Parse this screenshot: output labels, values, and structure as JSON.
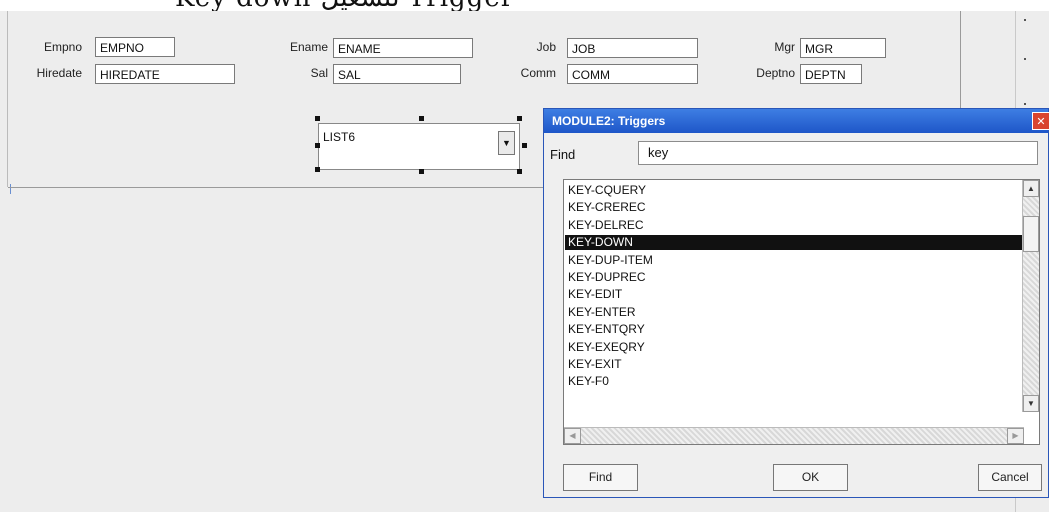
{
  "banner": {
    "text": "Key down لتشغيل Trigger"
  },
  "form": {
    "fields": [
      {
        "label": "Empno",
        "value": "EMPNO"
      },
      {
        "label": "Hiredate",
        "value": "HIREDATE"
      },
      {
        "label": "Ename",
        "value": "ENAME"
      },
      {
        "label": "Sal",
        "value": "SAL"
      },
      {
        "label": "Job",
        "value": "JOB"
      },
      {
        "label": "Comm",
        "value": "COMM"
      },
      {
        "label": "Mgr",
        "value": "MGR"
      },
      {
        "label": "Deptno",
        "value": "DEPTN"
      }
    ],
    "list_item": {
      "value": "LIST6",
      "dropdown_icon": "chevron-down-icon"
    }
  },
  "dialog": {
    "title": "MODULE2: Triggers",
    "close_icon": "close-icon",
    "find_label": "Find",
    "find_value": "key",
    "triggers": [
      "KEY-CQUERY",
      "KEY-CREREC",
      "KEY-DELREC",
      "KEY-DOWN",
      "KEY-DUP-ITEM",
      "KEY-DUPREC",
      "KEY-EDIT",
      "KEY-ENTER",
      "KEY-ENTQRY",
      "KEY-EXEQRY",
      "KEY-EXIT",
      "KEY-F0"
    ],
    "selected_trigger": "KEY-DOWN",
    "buttons": {
      "find": "Find",
      "ok": "OK",
      "cancel": "Cancel"
    }
  }
}
